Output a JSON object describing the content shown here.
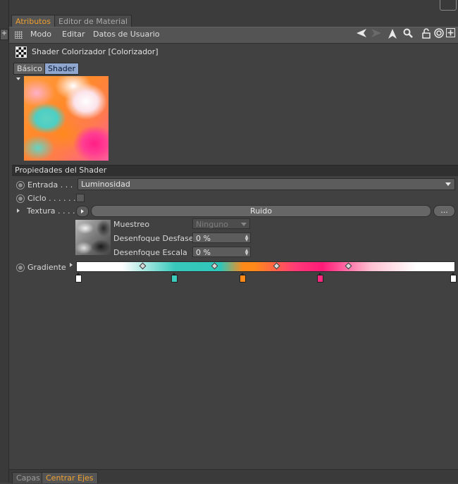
{
  "tabs": [
    {
      "label": "Atributos",
      "active": true
    },
    {
      "label": "Editor de Material",
      "active": false
    }
  ],
  "left_strip": {
    "top_button": "+"
  },
  "menu": {
    "items": [
      "Modo",
      "Editar",
      "Datos de Usuario"
    ]
  },
  "toolbar_icons": [
    "back-arrow-icon",
    "forward-arrow-icon",
    "up-arrow-icon",
    "search-icon",
    "lock-icon",
    "target-icon",
    "add-icon"
  ],
  "shader": {
    "title": "Shader Colorizador [Colorizador]"
  },
  "subtabs": [
    {
      "label": "Básico",
      "active": false
    },
    {
      "label": "Shader",
      "active": true
    }
  ],
  "section": {
    "title": "Propiedades del Shader"
  },
  "props": {
    "entrada": {
      "label": "Entrada . . .",
      "value": "Luminosidad"
    },
    "ciclo": {
      "label": "Ciclo . . . . . .",
      "checked": false
    },
    "textura": {
      "label": "Textura . . . .",
      "button": "Ruido",
      "more_button": "..."
    },
    "muestreo": {
      "label": "Muestreo",
      "value": "Ninguno"
    },
    "desenfoque_desfase": {
      "label": "Desenfoque Desfase",
      "value": "0 %"
    },
    "desenfoque_escala": {
      "label": "Desenfoque Escala",
      "value": "0 %"
    },
    "gradiente": {
      "label": "Gradiente"
    }
  },
  "gradient": {
    "knots": [
      {
        "color": "#ffffff",
        "position": 0.0
      },
      {
        "color": "#3ccbbd",
        "position": 0.26
      },
      {
        "color": "#ff8a1a",
        "position": 0.44
      },
      {
        "color": "#ff2a80",
        "position": 0.645
      },
      {
        "color": "#ffffff",
        "position": 1.0
      }
    ],
    "midpoints": [
      0.175,
      0.365,
      0.53,
      0.72
    ]
  },
  "bottom_tabs": [
    {
      "label": "Capas",
      "active": false
    },
    {
      "label": "Centrar Ejes",
      "active": true
    }
  ],
  "colors": {
    "accent": "#f0a030",
    "active_subtab": "#8fa6cf",
    "background": "#414141"
  }
}
